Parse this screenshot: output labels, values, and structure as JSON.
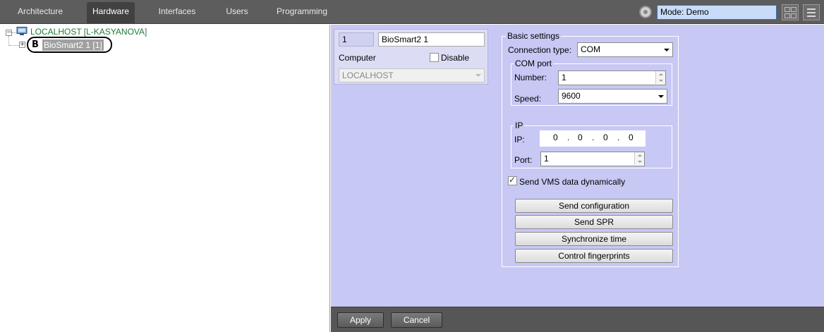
{
  "tabs": [
    {
      "label": "Architecture",
      "active": false
    },
    {
      "label": "Hardware",
      "active": true
    },
    {
      "label": "Interfaces",
      "active": false
    },
    {
      "label": "Users",
      "active": false
    },
    {
      "label": "Programming",
      "active": false
    }
  ],
  "mode": {
    "label": "Mode: Demo",
    "icon": "mode-icon"
  },
  "tree": {
    "host": "LOCALHOST [L-KASYANOVA]",
    "device_icon_letter": "B",
    "device": "BioSmart2 1 [1]"
  },
  "object": {
    "number": "1",
    "name": "BioSmart2 1",
    "computer_label": "Computer",
    "disable_label": "Disable",
    "disable_checked": false,
    "computer_value": "LOCALHOST"
  },
  "basic": {
    "title": "Basic settings",
    "connection_type_label": "Connection type:",
    "connection_type_value": "COM",
    "com_port": {
      "title": "COM port",
      "number_label": "Number:",
      "number_value": "1",
      "speed_label": "Speed:",
      "speed_value": "9600"
    },
    "ip": {
      "title": "IP",
      "ip_label": "IP:",
      "octets": [
        "0",
        "0",
        "0",
        "0"
      ],
      "port_label": "Port:",
      "port_value": "1"
    },
    "send_vms_label": "Send VMS data dynamically",
    "send_vms_checked": true
  },
  "actions": {
    "send_configuration": "Send configuration",
    "send_spr": "Send SPR",
    "synchronize_time": "Synchronize time",
    "control_fingerprints": "Control fingerprints"
  },
  "footer": {
    "apply": "Apply",
    "cancel": "Cancel"
  },
  "colors": {
    "panel_bg": "#c8c8f5",
    "topbar_bg": "#5d5d5d",
    "host_text": "#1e7a35",
    "mode_bg": "#c8dcfa"
  }
}
